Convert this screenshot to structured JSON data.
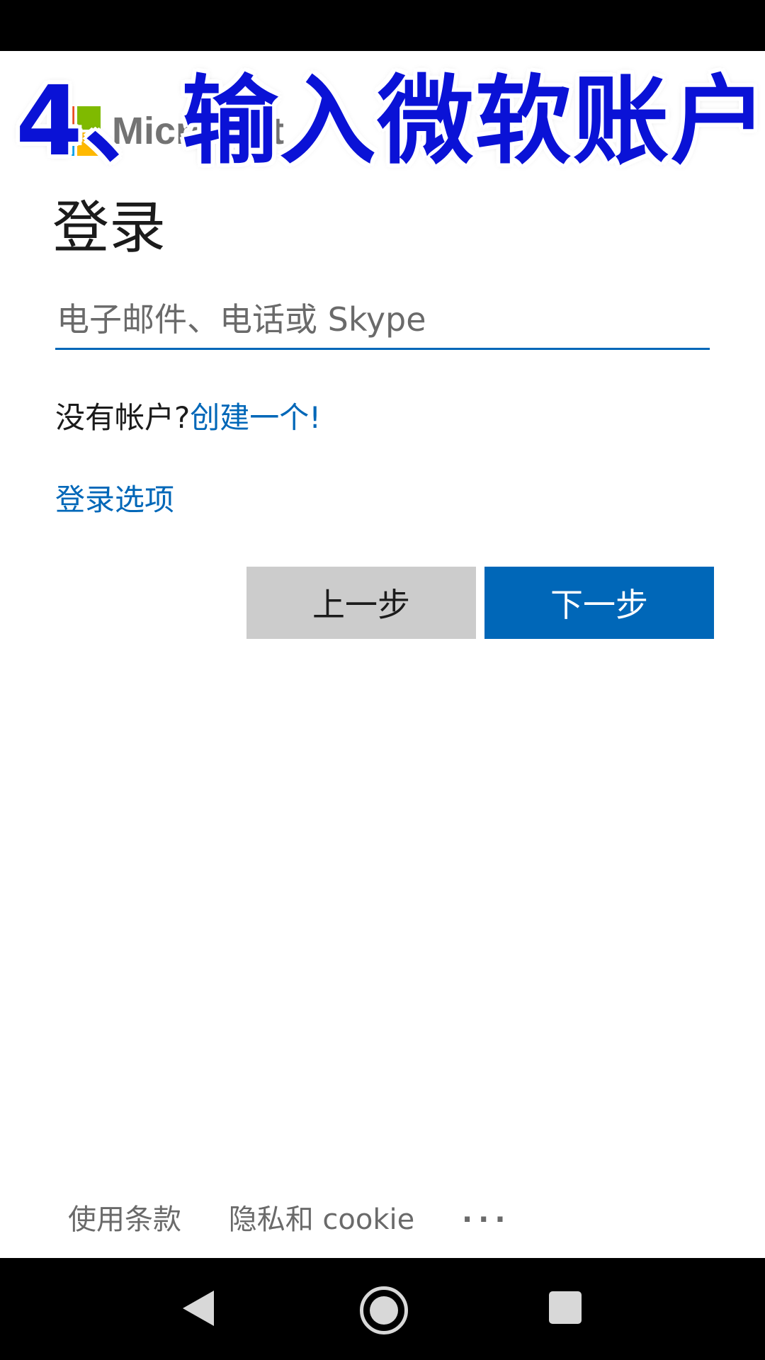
{
  "brand": {
    "name": "Microsoft"
  },
  "overlay_caption": "4、输入微软账户",
  "page": {
    "title": "登录"
  },
  "email_input": {
    "placeholder": "电子邮件、电话或 Skype",
    "value": ""
  },
  "no_account": {
    "text": "没有帐户?",
    "create_link": "创建一个!"
  },
  "signin_options_link": "登录选项",
  "buttons": {
    "back": "上一步",
    "next": "下一步"
  },
  "footer": {
    "terms": "使用条款",
    "privacy": "隐私和 cookie",
    "more": "···"
  },
  "colors": {
    "accent": "#0067b8",
    "caption": "#0a12d6",
    "back_button": "#cccccc"
  },
  "icons": [
    "microsoft-logo-icon",
    "nav-back-icon",
    "nav-home-icon",
    "nav-recents-icon"
  ]
}
